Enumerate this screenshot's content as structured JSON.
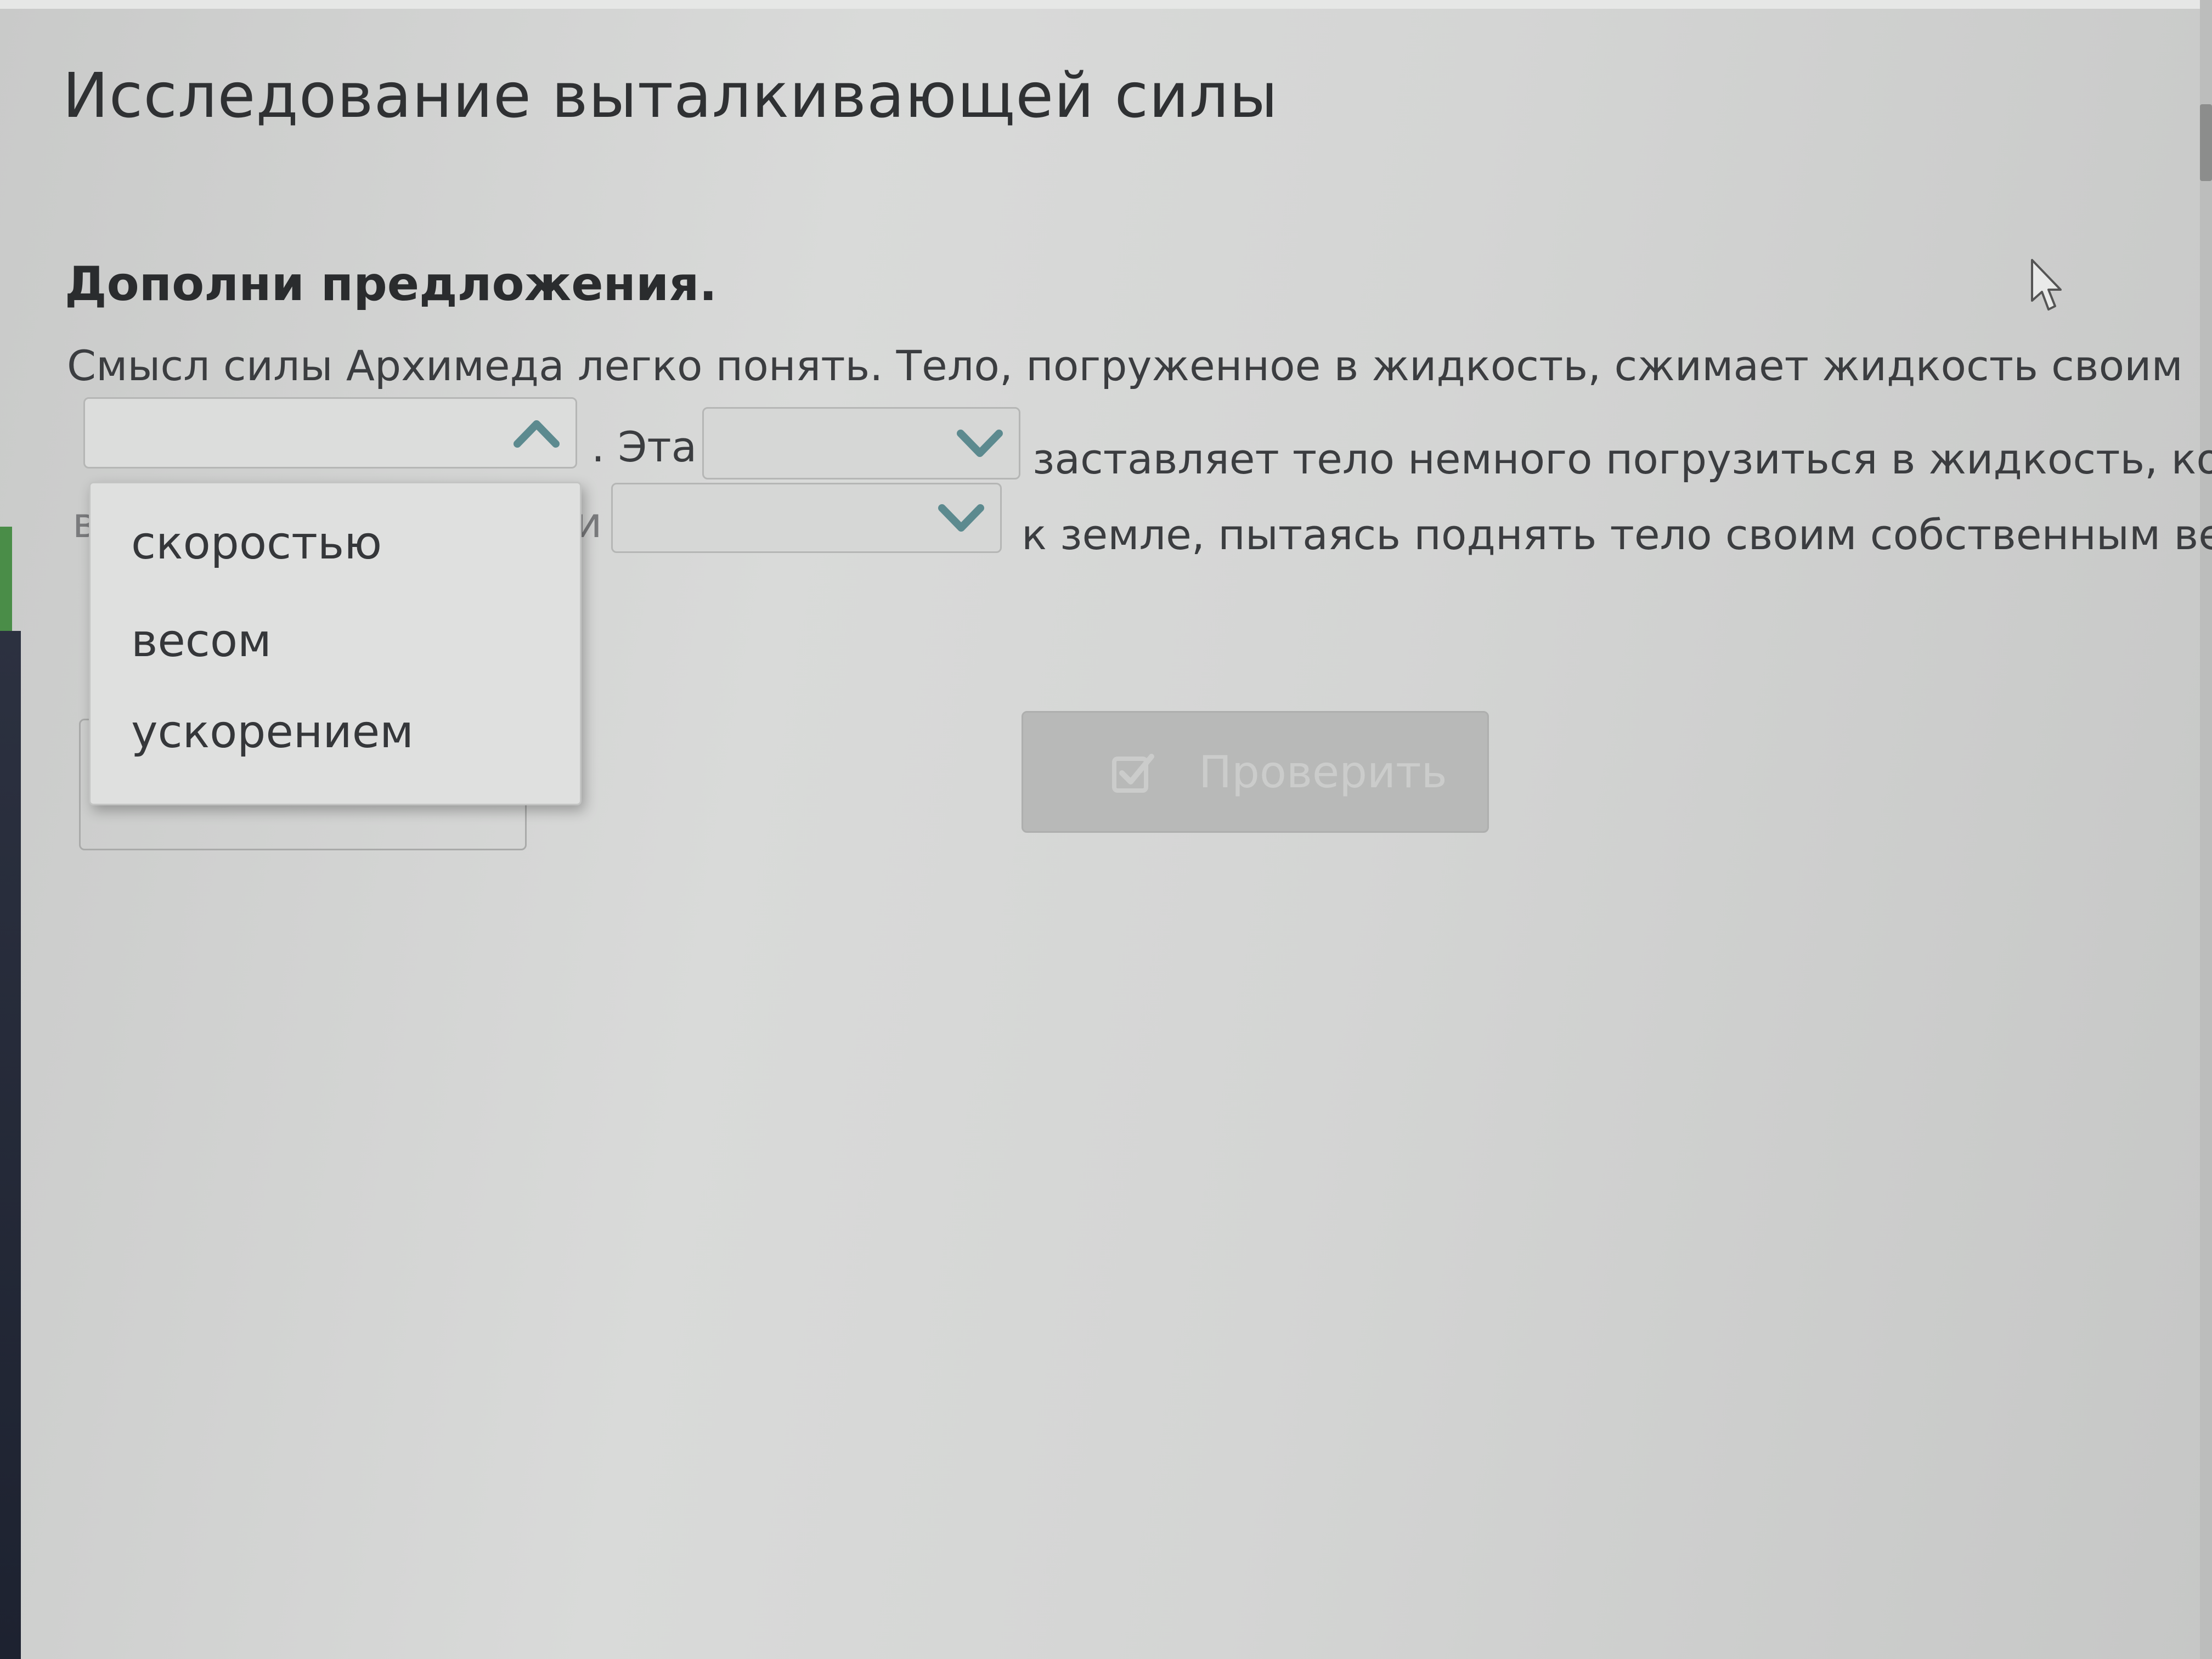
{
  "page": {
    "title": "Исследование выталкивающей силы",
    "instruction": "Дополни предложения."
  },
  "exercise": {
    "line1": "Смысл силы Архимеда легко понять. Тело, погруженное в жидкость, сжимает жидкость своим",
    "after_select1": ". Эта",
    "after_select2": "заставляет тело немного погрузиться в жидкость, количество",
    "line3_start_fragment": "в",
    "before_select3_fragment": "и",
    "after_select3": "к земле, пытаясь поднять тело своим собственным весом"
  },
  "selects": {
    "select1": {
      "value": "",
      "state": "open",
      "icon": "chevron-up-icon"
    },
    "select2": {
      "value": "",
      "state": "closed",
      "icon": "chevron-down-icon"
    },
    "select3": {
      "value": "",
      "state": "closed",
      "icon": "chevron-down-icon"
    }
  },
  "dropdown": {
    "options": [
      "скоростью",
      "весом",
      "ускорением"
    ]
  },
  "check_button": {
    "label": "Проверить",
    "icon": "checkbox-icon",
    "state": "disabled"
  },
  "colors": {
    "background": "#d4d5d4",
    "text": "#3b3d40",
    "chevron": "#5c8a8f",
    "button_disabled": "#b8b9b8",
    "left_accent": "#4a8d48"
  }
}
